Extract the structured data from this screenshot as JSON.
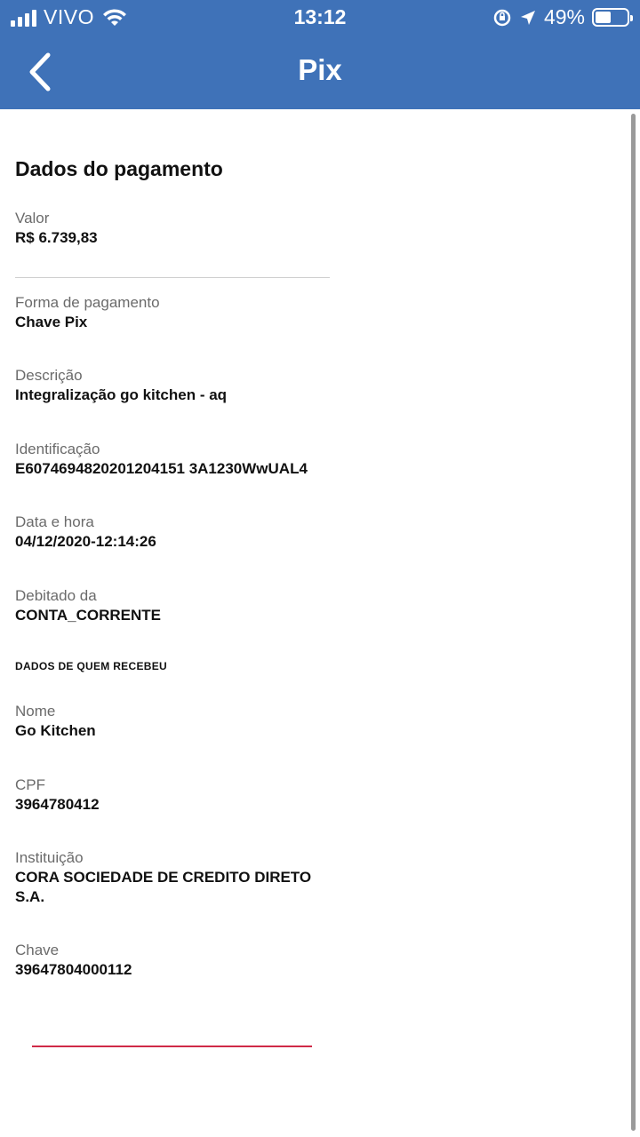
{
  "status_bar": {
    "carrier": "VIVO",
    "time": "13:12",
    "battery": "49%",
    "battery_level": 0.49,
    "icons": [
      "signal-icon",
      "wifi-icon",
      "rotation-lock-icon",
      "location-icon",
      "battery-icon"
    ]
  },
  "header": {
    "title": "Pix",
    "back_icon": "chevron-left-icon",
    "background": "#3f72b8"
  },
  "payment": {
    "section_title": "Dados do pagamento",
    "valor": {
      "label": "Valor",
      "value": "R$ 6.739,83"
    },
    "forma": {
      "label": "Forma de pagamento",
      "value": "Chave Pix"
    },
    "descricao": {
      "label": "Descrição",
      "value": "Integralização go kitchen - aq"
    },
    "identificacao": {
      "label": "Identificação",
      "value": "E6074694820201204151 3A1230WwUAL4"
    },
    "data_hora": {
      "label": "Data e hora",
      "value": "04/12/2020-12:14:26"
    },
    "debitado": {
      "label": "Debitado da",
      "value": "CONTA_CORRENTE"
    }
  },
  "recipient": {
    "heading": "DADOS DE QUEM RECEBEU",
    "nome": {
      "label": "Nome",
      "value": "Go Kitchen"
    },
    "cpf": {
      "label": "CPF",
      "value": "3964780412"
    },
    "instituicao": {
      "label": "Instituição",
      "value": "CORA SOCIEDADE DE CREDITO DIRETO S.A."
    },
    "chave": {
      "label": "Chave",
      "value": "39647804000112"
    }
  }
}
